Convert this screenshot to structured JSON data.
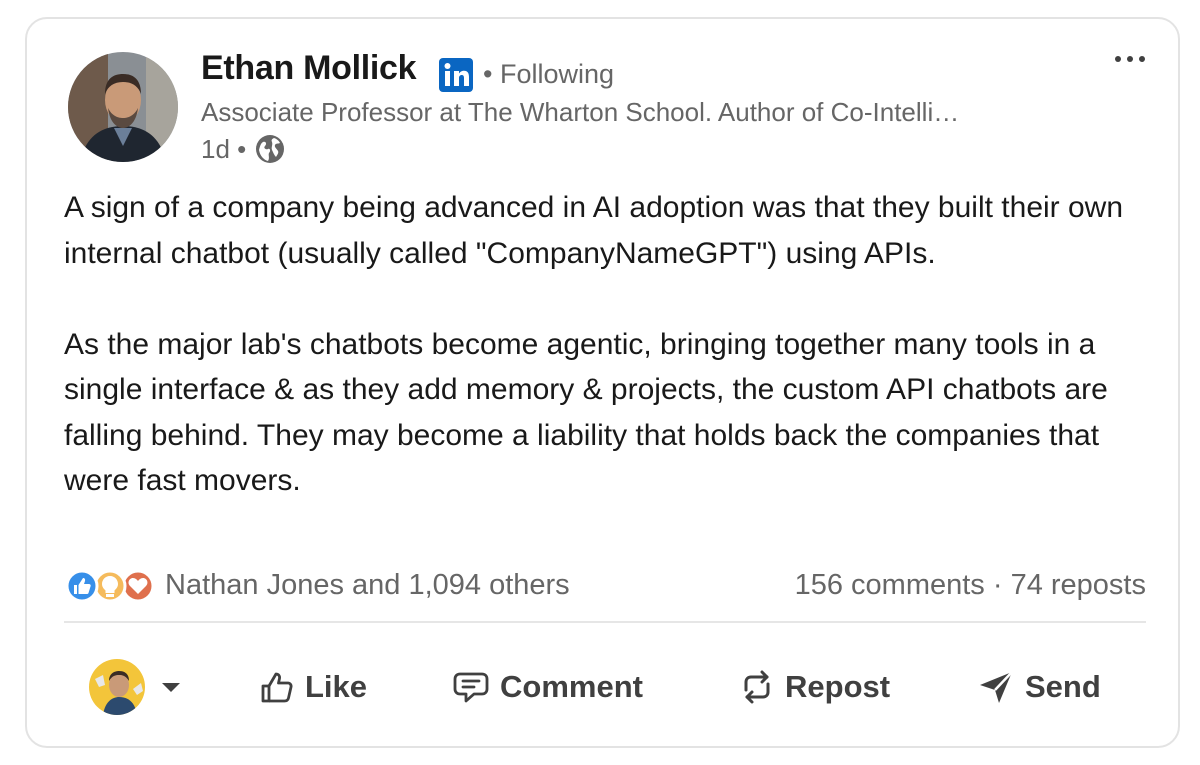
{
  "post": {
    "author": {
      "name": "Ethan Mollick",
      "badge_icon": "linkedin-icon",
      "follow_status": "• Following",
      "headline": "Associate Professor at The Wharton School. Author of Co-Intelli…",
      "time": "1d •",
      "visibility_icon": "globe-icon"
    },
    "more_icon": "more-options-icon",
    "paragraphs": [
      "A sign of a company being advanced in AI adoption was that they built their own internal chatbot (usually called \"CompanyNameGPT\") using APIs.",
      "As the major lab's chatbots become agentic, bringing together many tools in a single interface & as they add memory & projects, the custom API chatbots are falling behind. They may become a liability that holds back the companies that were fast movers."
    ],
    "reactions": {
      "icons": [
        "like-reaction-icon",
        "insightful-reaction-icon",
        "love-reaction-icon"
      ],
      "summary": "Nathan Jones and 1,094 others",
      "stats": "156 comments · 74 reposts"
    },
    "actions": {
      "like": "Like",
      "comment": "Comment",
      "repost": "Repost",
      "send": "Send"
    }
  },
  "colors": {
    "linkedin_blue": "#0a66c2",
    "secondary_text": "#666666",
    "primary_text": "#191919",
    "action_text": "#404040"
  }
}
